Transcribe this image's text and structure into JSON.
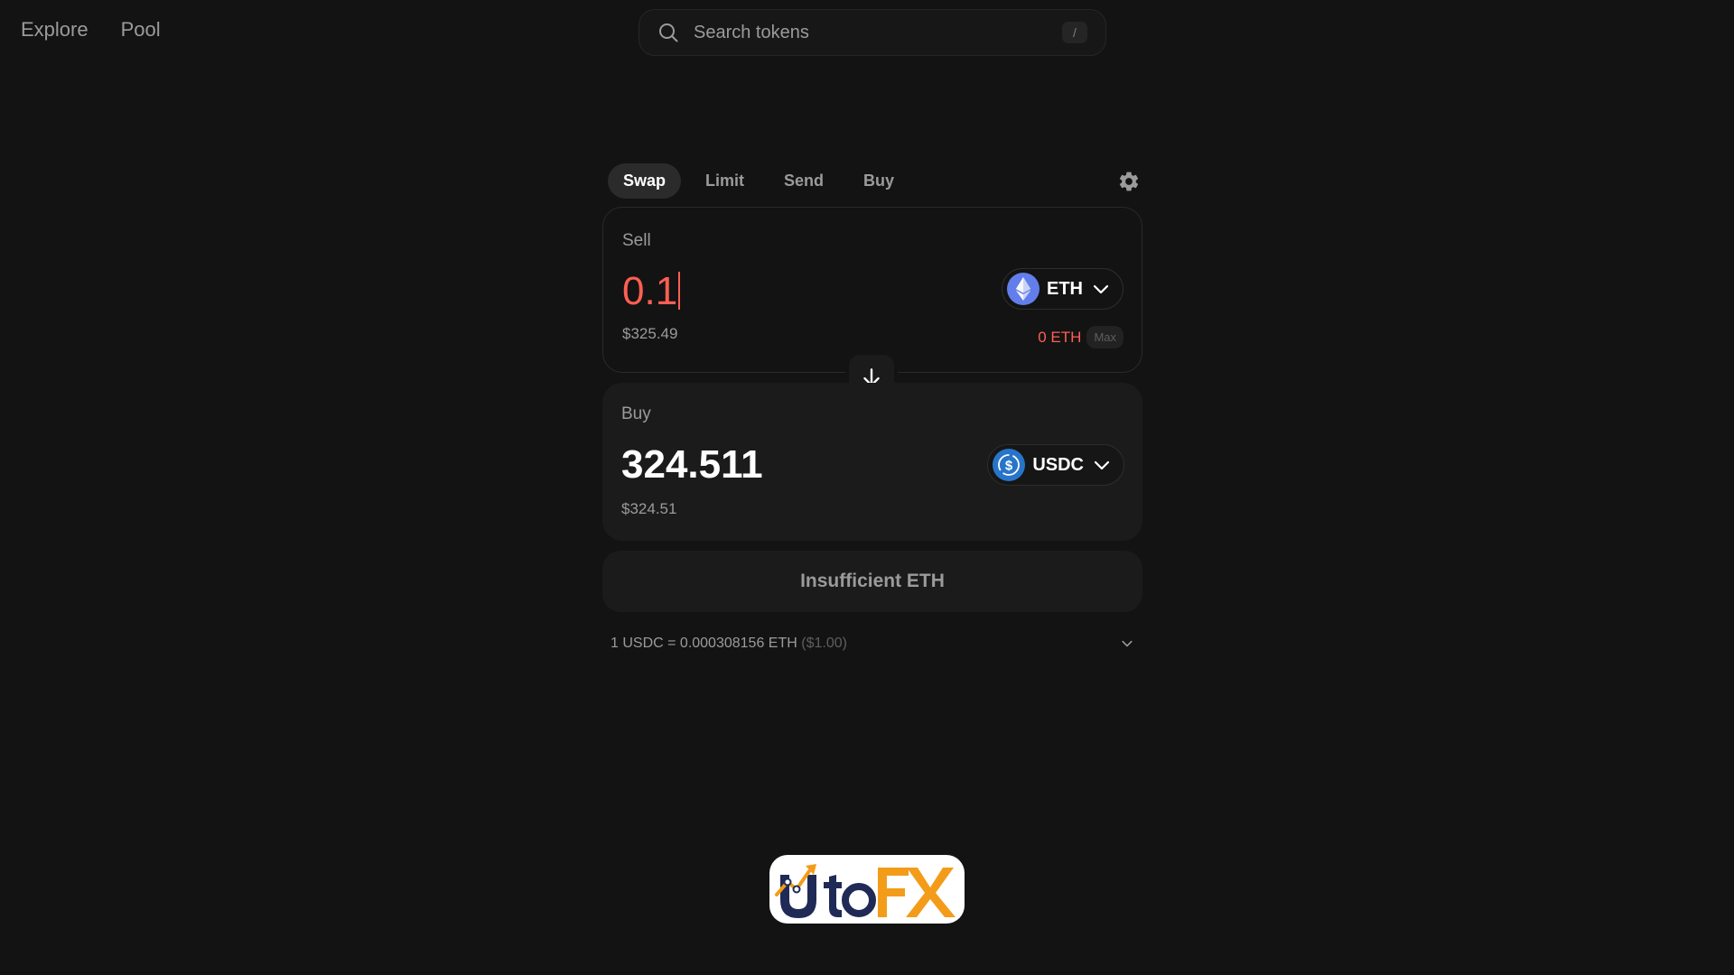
{
  "nav": {
    "items": [
      "Explore",
      "Pool"
    ]
  },
  "search": {
    "placeholder": "Search tokens",
    "shortcut": "/"
  },
  "tabs": [
    {
      "label": "Swap",
      "active": true
    },
    {
      "label": "Limit",
      "active": false
    },
    {
      "label": "Send",
      "active": false
    },
    {
      "label": "Buy",
      "active": false
    }
  ],
  "sell": {
    "label": "Sell",
    "amount": "0.1",
    "usd_value": "$325.49",
    "token": "ETH",
    "token_icon": "eth-icon",
    "balance": "0 ETH",
    "max_label": "Max"
  },
  "buy": {
    "label": "Buy",
    "amount": "324.511",
    "usd_value": "$324.51",
    "token": "USDC",
    "token_icon": "usdc-icon"
  },
  "action_button": {
    "label": "Insufficient ETH"
  },
  "rate": {
    "text": "1 USDC = 0.000308156 ETH",
    "usd": "($1.00)"
  },
  "watermark": {
    "text": "UtoFX"
  },
  "colors": {
    "background": "#131313",
    "error_red": "#ff5f52",
    "muted_text": "#9b9b9b",
    "eth_blue": "#627eea",
    "usdc_blue": "#2775ca",
    "logo_orange": "#f39c19",
    "logo_navy": "#1f2a56"
  }
}
